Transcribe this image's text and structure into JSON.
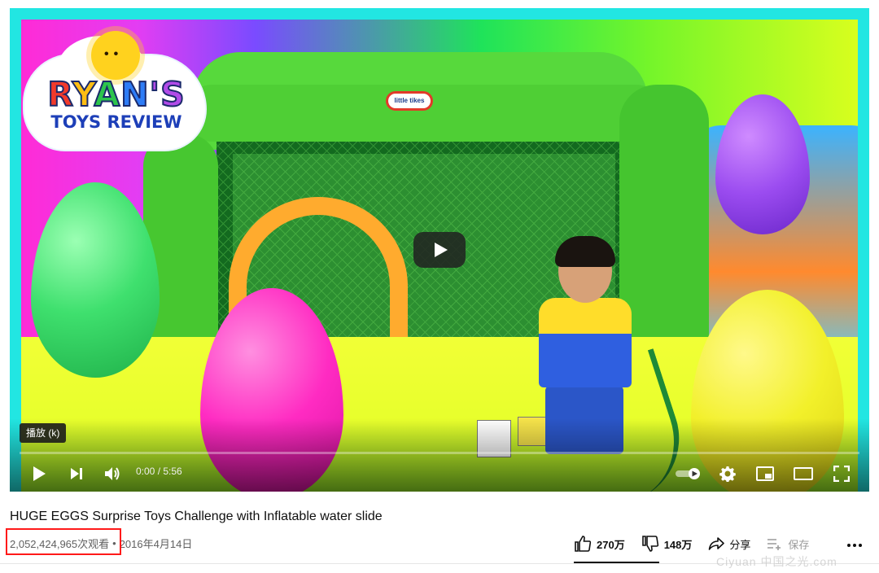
{
  "video": {
    "brand_line1": "RYAN'S",
    "brand_line2": "TOYS REVIEW",
    "box_logo": "little tikes",
    "tooltip": "播放 (k)",
    "time": "0:00 / 5:56",
    "progress": 0
  },
  "info": {
    "title": "HUGE EGGS Surprise Toys Challenge with Inflatable water slide",
    "views": "2,052,424,965次观看",
    "separator": "•",
    "date": "2016年4月14日"
  },
  "actions": {
    "like": "270万",
    "dislike": "148万",
    "share": "分享",
    "save": "保存"
  },
  "watermark": "Ciyuan 中国之光.com",
  "colors": {
    "accent": "#ff0000",
    "highlight_box": "#ff1a1a",
    "frame": "#22e6e2"
  }
}
